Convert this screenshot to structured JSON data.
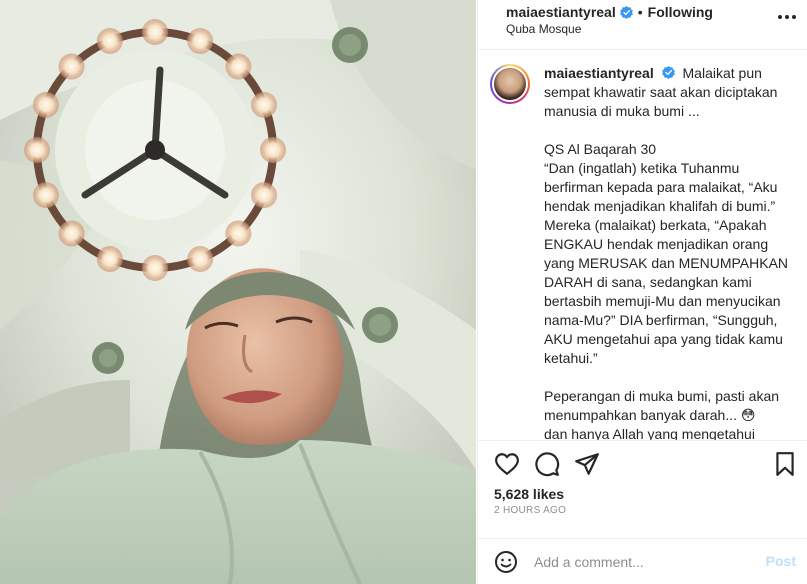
{
  "post": {
    "username": "maiaestiantyreal",
    "follow_status": "Following",
    "separator": "•",
    "location": "Quba Mosque"
  },
  "caption": {
    "username": "maiaestiantyreal",
    "lines": [
      "Malaikat pun sempat khawatir saat akan diciptakan manusia di muka bumi ...",
      "",
      "QS Al Baqarah 30",
      "“Dan (ingatlah) ketika Tuhanmu berfirman kepada para malaikat, “Aku hendak menjadikan khalifah di bumi.” Mereka (malaikat) berkata, “Apakah ENGKAU hendak menjadikan orang yang MERUSAK dan MENUMPAHKAN DARAH di sana, sedangkan kami bertasbih memuji-Mu dan menyucikan nama-Mu?” DIA berfirman, “Sungguh, AKU mengetahui apa yang tidak kamu ketahui.”",
      "",
      "Peperangan di muka bumi, pasti akan menumpahkan banyak darah... 😳",
      "dan hanya Allah yang mengetahui maksudnya..."
    ]
  },
  "engagement": {
    "likes": "5,628 likes",
    "time_ago": "2 HOURS AGO"
  },
  "comment": {
    "placeholder": "Add a comment...",
    "post_label": "Post"
  },
  "icons": {
    "like": "heart-icon",
    "comment": "comment-icon",
    "share": "paper-plane-icon",
    "save": "bookmark-icon",
    "more": "more-options-icon",
    "emoji": "emoji-icon",
    "verified": "verified-badge-icon"
  },
  "colors": {
    "verified": "#3897f0",
    "post_button_disabled": "#c0dffd",
    "muted_text": "#8e8e8e"
  }
}
